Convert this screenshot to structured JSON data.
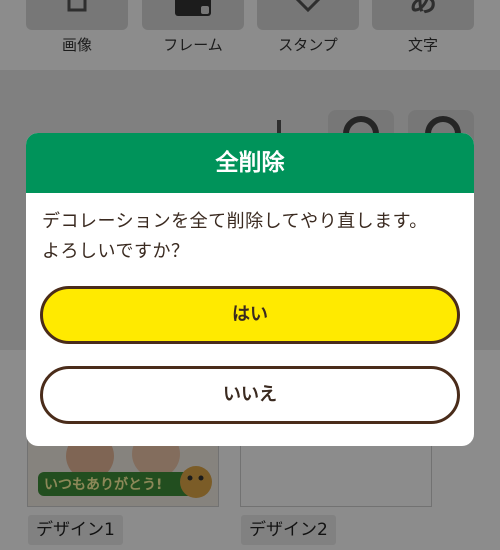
{
  "toolbar": {
    "items": [
      {
        "label": "画像",
        "icon": "image-icon"
      },
      {
        "label": "フレーム",
        "icon": "frame-icon"
      },
      {
        "label": "スタンプ",
        "icon": "stamp-icon"
      },
      {
        "label": "文字",
        "icon": "text-icon",
        "glyph": "あ"
      }
    ]
  },
  "designs": [
    {
      "label": "デザイン1",
      "thumb_text": "いつもありがとう!"
    },
    {
      "label": "デザイン2"
    }
  ],
  "dialog": {
    "title": "全削除",
    "message_line1": "デコレーションを全て削除してやり直します。",
    "message_line2": "よろしいですか？",
    "yes_label": "はい",
    "no_label": "いいえ"
  },
  "colors": {
    "header_green": "#00935a",
    "yes_yellow": "#ffea00",
    "button_border": "#4a2c1a"
  }
}
